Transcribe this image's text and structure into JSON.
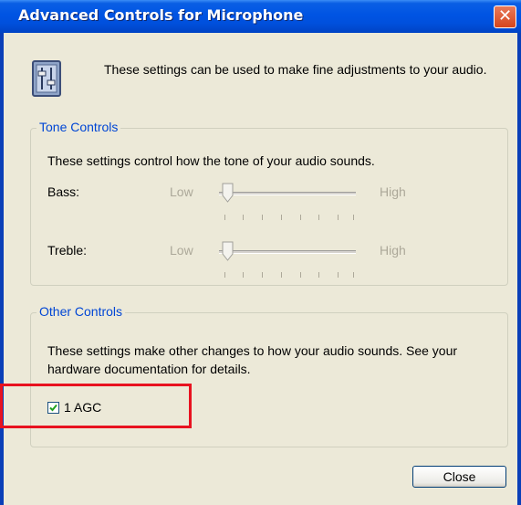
{
  "window": {
    "title": "Advanced Controls for Microphone",
    "close_glyph": "✕"
  },
  "intro": {
    "icon": "mixer-icon",
    "text": "These settings can be used to make fine adjustments to your audio."
  },
  "tone_controls": {
    "legend": "Tone Controls",
    "description": "These settings control how the tone of your audio sounds.",
    "sliders": [
      {
        "label": "Bass:",
        "low": "Low",
        "high": "High",
        "value": 0,
        "enabled": false
      },
      {
        "label": "Treble:",
        "low": "Low",
        "high": "High",
        "value": 0,
        "enabled": false
      }
    ]
  },
  "other_controls": {
    "legend": "Other Controls",
    "description": "These settings make other changes to how your audio sounds.  See your hardware documentation for details.",
    "agc": {
      "label": "1 AGC",
      "checked": true
    }
  },
  "buttons": {
    "close": "Close"
  },
  "colors": {
    "titlebar": "#0054e3",
    "window_bg": "#ece9d8",
    "group_legend": "#0046d5",
    "highlight_box": "#e8121f",
    "check": "#21a121"
  }
}
